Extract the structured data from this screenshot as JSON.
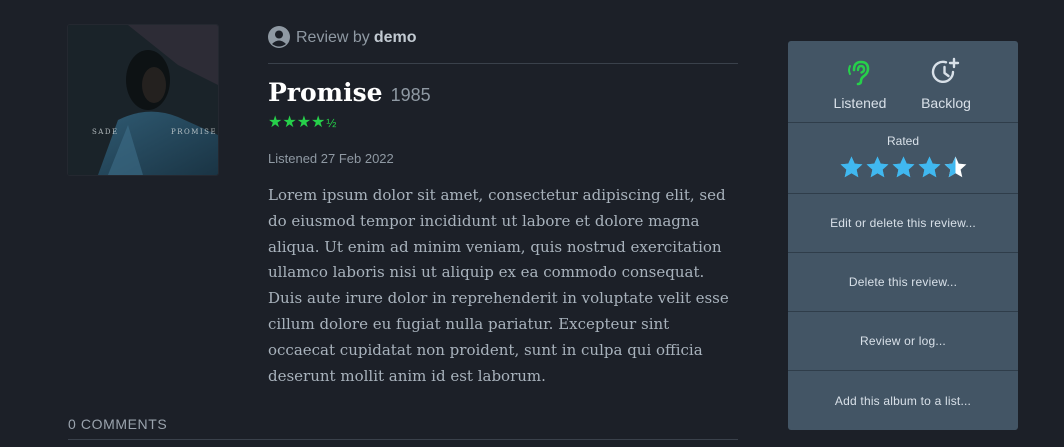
{
  "cover": {
    "artist": "SADE",
    "title": "PROMISE"
  },
  "review": {
    "byline_prefix": "Review by",
    "user": "demo",
    "album_title": "Promise",
    "year": "1985",
    "stars_symbol": "★★★★",
    "half_symbol": "½",
    "rating": 4.5,
    "listened": "Listened 27 Feb 2022",
    "body": "Lorem ipsum dolor sit amet, consectetur adipiscing elit, sed do eiusmod tempor incididunt ut labore et dolore magna aliqua. Ut enim ad minim veniam, quis nostrud exercitation ullamco laboris nisi ut aliquip ex ea commodo consequat. Duis aute irure dolor in reprehenderit in voluptate velit esse cillum dolore eu fugiat nulla pariatur. Excepteur sint occaecat cupidatat non proident, sunt in culpa qui officia deserunt mollit anim id est laborum."
  },
  "comments": {
    "header": "0 COMMENTS"
  },
  "sidebar": {
    "listened_label": "Listened",
    "backlog_label": "Backlog",
    "rated_label": "Rated",
    "user_rating": 4.5,
    "menu": [
      "Edit or delete this review...",
      "Delete this review...",
      "Review or log...",
      "Add this album to a list..."
    ]
  },
  "colors": {
    "background": "#1c2028",
    "panel": "#435565",
    "accent_green": "#26d04a",
    "rating_blue": "#40b8f0"
  },
  "icons": [
    "user-icon",
    "ear-icon",
    "clock-plus-icon",
    "star-icon"
  ]
}
